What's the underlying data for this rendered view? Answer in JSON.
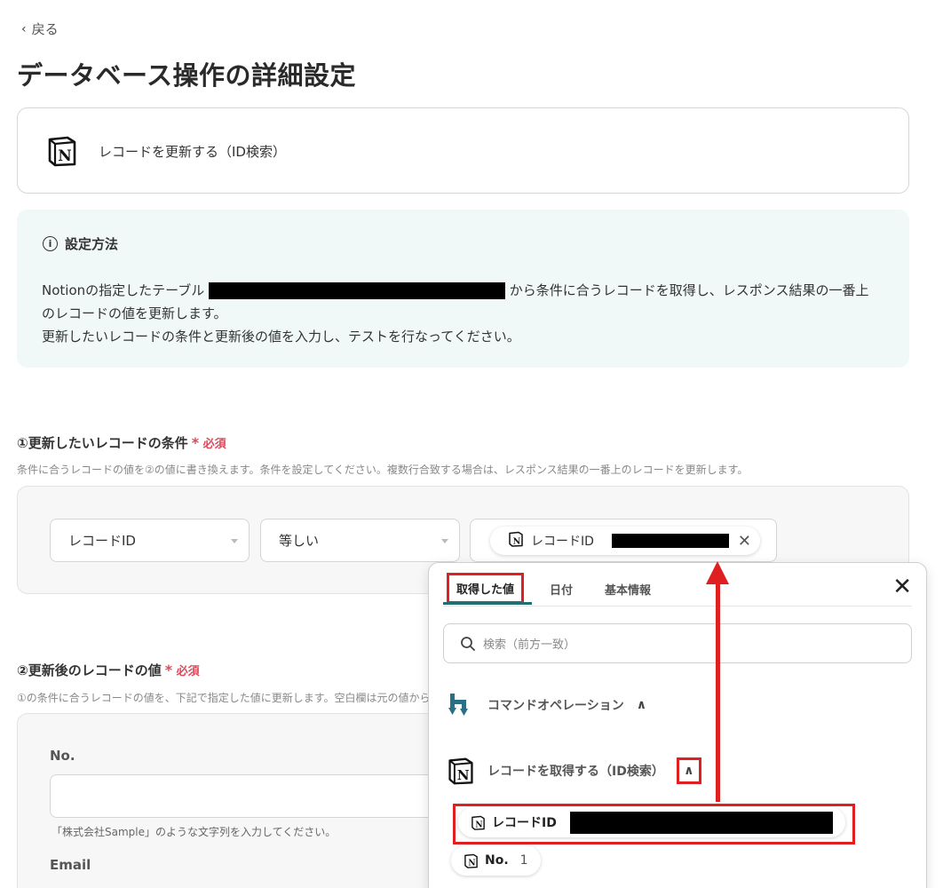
{
  "nav": {
    "back_label": "戻る"
  },
  "page": {
    "title": "データベース操作の詳細設定"
  },
  "action": {
    "label": "レコードを更新する（ID検索）"
  },
  "info": {
    "heading": "設定方法",
    "line1_pre": "Notionの指定したテーブル",
    "line1_post": "から条件に合うレコードを取得し、レスポンス結果の一番上",
    "line2": "のレコードの値を更新します。",
    "line3": "更新したいレコードの条件と更新後の値を入力し、テストを行なってください。"
  },
  "section1": {
    "title": "①更新したいレコードの条件",
    "required": "必須",
    "description": "条件に合うレコードの値を②の値に書き換えます。条件を設定してください。複数行合致する場合は、レスポンス結果の一番上のレコードを更新します。",
    "field_select": "レコードID",
    "operator_select": "等しい",
    "value_chip_label": "レコードID"
  },
  "section2": {
    "title": "②更新後のレコードの値",
    "required": "必須",
    "description": "①の条件に合うレコードの値を、下記で指定した値に更新します。空白欄は元の値から",
    "fields": [
      {
        "label": "No.",
        "hint": "「株式会社Sample」のような文字列を入力してください。"
      },
      {
        "label": "Email"
      }
    ]
  },
  "popup": {
    "tabs": [
      "取得した値",
      "日付",
      "基本情報"
    ],
    "active_tab": "取得した値",
    "search_placeholder": "検索（前方一致）",
    "groups": [
      {
        "label": "コマンドオペレーション",
        "icon": "yoom-command-icon"
      },
      {
        "label": "レコードを取得する（ID検索）",
        "icon": "notion-icon"
      }
    ],
    "items": [
      {
        "label": "レコードID",
        "value": ""
      },
      {
        "label": "No.",
        "value": "1"
      }
    ]
  },
  "colors": {
    "annotation_red": "#e02020",
    "required_red": "#e0475a",
    "info_bg": "#f0f8f8",
    "tab_accent": "#1f6f73"
  }
}
